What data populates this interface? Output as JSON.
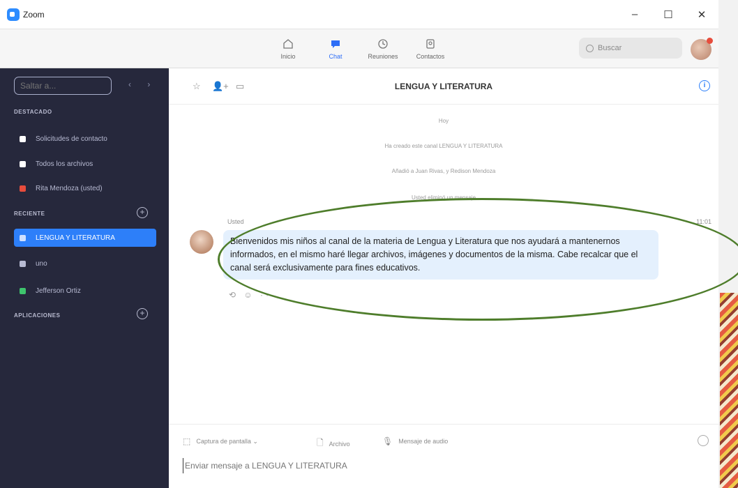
{
  "window": {
    "title": "Zoom",
    "controls": [
      "–",
      "☐",
      "✕"
    ]
  },
  "nav": {
    "tabs": [
      {
        "label": "Inicio",
        "icon": "home-icon"
      },
      {
        "label": "Chat",
        "icon": "chat-icon",
        "active": true
      },
      {
        "label": "Reuniones",
        "icon": "clock-icon"
      },
      {
        "label": "Contactos",
        "icon": "contacts-icon"
      }
    ],
    "search_placeholder": "Buscar"
  },
  "sidebar": {
    "jump_placeholder": "Saltar a...",
    "nav_arrows": "‹ ›",
    "starred_label": "DESTACADO",
    "starred_items": [
      {
        "label": "Solicitudes de contacto",
        "icon": "contact-request-icon",
        "color": "#ffffff"
      },
      {
        "label": "Todos los archivos",
        "icon": "file-icon",
        "color": "#ffffff"
      },
      {
        "label": "Rita Mendoza (usted)",
        "icon": "personal-icon",
        "color": "#e74c3c"
      }
    ],
    "recent_label": "RECIENTE",
    "recent_items": [
      {
        "label": "LENGUA Y LITERATURA",
        "icon": "channel-icon",
        "active": true
      },
      {
        "label": "uno",
        "icon": "channel-icon"
      },
      {
        "label": "Jefferson Ortiz",
        "icon": "user-icon",
        "color": "#3ec46d"
      }
    ],
    "apps_label": "APLICACIONES",
    "add_symbol": "+"
  },
  "channel": {
    "title": "LENGUA Y LITERATURA",
    "info_symbol": "i",
    "header_icons": [
      "☆",
      "👤+",
      "▭"
    ],
    "system_messages": [
      "Hoy",
      "Ha creado este canal LENGUA Y LITERATURA",
      "Añadió a Juan Rivas, y Redison Mendoza",
      "Usted eliminó un mensaje"
    ],
    "message": {
      "author": "Usted",
      "time": "11:01",
      "text": "Bienvenidos mis niños al canal de la materia de Lengua y Literatura que nos ayudará a mantenernos informados, en el mismo haré llegar archivos, imágenes y documentos de la misma. Cabe recalcar que el canal será exclusivamente para fines educativos.",
      "actions": "⟲ ☺ ···"
    }
  },
  "composer": {
    "tools": [
      {
        "label": "Captura de pantalla  ⌄",
        "icon": "screenshot-icon"
      },
      {
        "label": "Archivo",
        "icon": "file-icon"
      },
      {
        "label": "Mensaje de audio",
        "icon": "microphone-icon"
      }
    ],
    "placeholder": "Enviar mensaje a LENGUA Y LITERATURA"
  }
}
